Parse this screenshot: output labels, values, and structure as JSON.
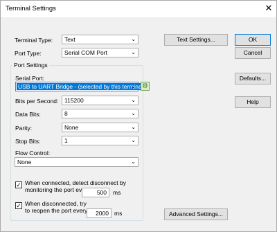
{
  "window": {
    "title": "Terminal Settings",
    "close_glyph": "✕"
  },
  "terminal_type": {
    "label": "Terminal Type:",
    "value": "Text"
  },
  "port_type": {
    "label": "Port Type:",
    "value": "Serial COM Port"
  },
  "buttons": {
    "text_settings": "Text Settings...",
    "ok": "OK",
    "cancel": "Cancel",
    "defaults": "Defaults...",
    "help": "Help",
    "advanced_settings": "Advanced Settings..."
  },
  "port_settings": {
    "title": "Port Settings",
    "serial_port": {
      "label": "Serial Port:",
      "value": "USB to UART Bridge - (selected by this terminal)"
    },
    "bits_per_second": {
      "label": "Bits per Second:",
      "value": "115200"
    },
    "data_bits": {
      "label": "Data Bits:",
      "value": "8"
    },
    "parity": {
      "label": "Parity:",
      "value": "None"
    },
    "stop_bits": {
      "label": "Stop Bits:",
      "value": "1"
    },
    "flow_control": {
      "label": "Flow Control:",
      "value": "None"
    }
  },
  "disconnect_detect": {
    "checked": true,
    "line1": "When connected, detect disconnect by",
    "line2": "monitoring the port every",
    "value": "500",
    "unit": "ms"
  },
  "reconnect": {
    "checked": true,
    "line1": "When disconnected, try",
    "line2": "to reopen the port every",
    "value": "2000",
    "unit": "ms"
  },
  "icons": {
    "dropdown_arrow": "⌄",
    "checkmark": "✓",
    "refresh_ports": "⚙"
  }
}
